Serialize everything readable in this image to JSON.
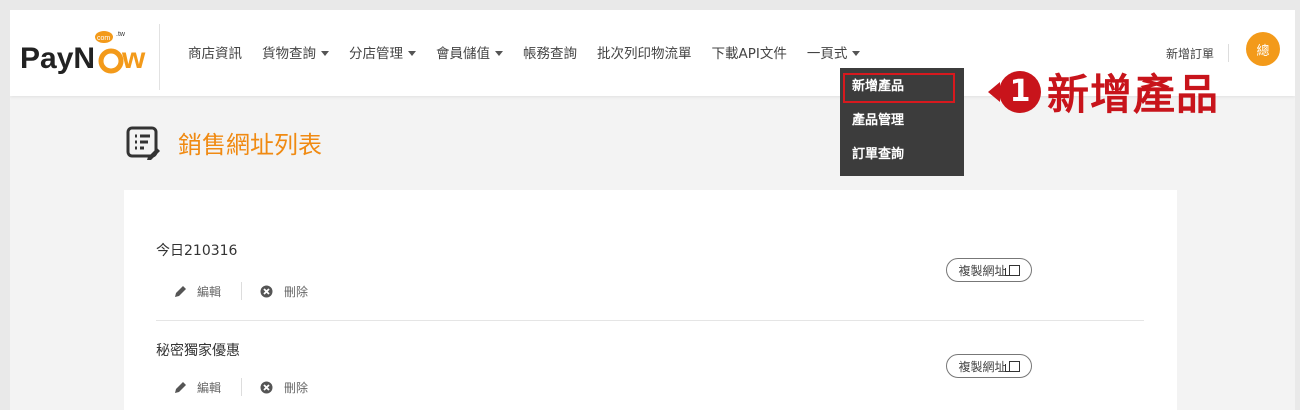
{
  "brand": {
    "logo_main": "PayN",
    "logo_tail": "w",
    "logo_badge": "com",
    "logo_tld": ".tw",
    "accent_color": "#f39a1a",
    "highlight_color": "#c8141b"
  },
  "nav": {
    "items": [
      {
        "label": "商店資訊",
        "has_caret": false
      },
      {
        "label": "貨物查詢",
        "has_caret": true
      },
      {
        "label": "分店管理",
        "has_caret": true
      },
      {
        "label": "會員儲值",
        "has_caret": true
      },
      {
        "label": "帳務查詢",
        "has_caret": false
      },
      {
        "label": "批次列印物流單",
        "has_caret": false
      },
      {
        "label": "下載API文件",
        "has_caret": false
      },
      {
        "label": "一頁式",
        "has_caret": true
      }
    ],
    "new_order": "新增訂單",
    "avatar_text": "總"
  },
  "dropdown": {
    "items": [
      {
        "label": "新增產品",
        "highlighted": true
      },
      {
        "label": "產品管理",
        "highlighted": false
      },
      {
        "label": "訂單查詢",
        "highlighted": false
      }
    ]
  },
  "callout": {
    "number": "1",
    "text": "新增產品"
  },
  "page": {
    "title": "銷售網址列表",
    "title_icon": "list-edit-icon"
  },
  "list": {
    "edit_label": "編輯",
    "delete_label": "刪除",
    "copy_label": "複製網址",
    "items": [
      {
        "name": "今日210316"
      },
      {
        "name": "秘密獨家優惠"
      }
    ]
  }
}
